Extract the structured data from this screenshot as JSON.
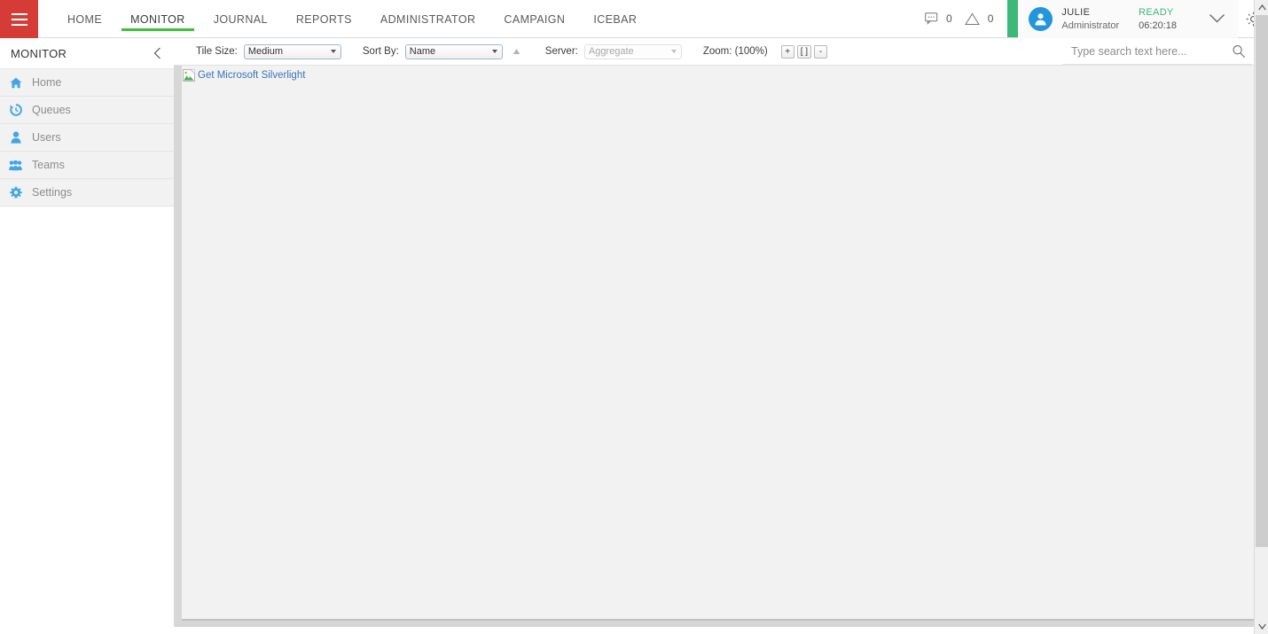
{
  "header": {
    "menu_icon": "hamburger-icon",
    "tabs": [
      {
        "label": "HOME",
        "active": false
      },
      {
        "label": "MONITOR",
        "active": true
      },
      {
        "label": "JOURNAL",
        "active": false
      },
      {
        "label": "REPORTS",
        "active": false
      },
      {
        "label": "ADMINISTRATOR",
        "active": false
      },
      {
        "label": "CAMPAIGN",
        "active": false
      },
      {
        "label": "ICEBAR",
        "active": false
      }
    ],
    "notifications": {
      "messages_icon": "chat-bubble-icon",
      "messages_count": "0",
      "alerts_icon": "warning-triangle-icon",
      "alerts_count": "0"
    },
    "user": {
      "avatar_icon": "user-avatar-icon",
      "name": "JULIE",
      "role": "Administrator",
      "status": "READY",
      "timer": "06:20:18",
      "status_color": "#3cb878",
      "chevron_icon": "chevron-down-icon"
    },
    "settings_icon": "gear-icon",
    "accent_red": "#d63c36",
    "accent_green": "#3fc03b"
  },
  "sidebar": {
    "title": "MONITOR",
    "collapse_icon": "chevron-left-icon",
    "items": [
      {
        "label": "Home",
        "icon": "home-icon"
      },
      {
        "label": "Queues",
        "icon": "history-icon"
      },
      {
        "label": "Users",
        "icon": "user-icon"
      },
      {
        "label": "Teams",
        "icon": "group-icon"
      },
      {
        "label": "Settings",
        "icon": "gear-icon"
      }
    ]
  },
  "toolbar": {
    "tile_size_label": "Tile Size:",
    "tile_size_value": "Medium",
    "sort_by_label": "Sort By:",
    "sort_by_value": "Name",
    "sort_direction_icon": "sort-ascending-icon",
    "server_label": "Server:",
    "server_value": "Aggregate",
    "zoom_label": "Zoom: (100%)",
    "zoom_in": "+",
    "zoom_fit": "[ ]",
    "zoom_out": "-"
  },
  "search": {
    "placeholder": "Type search text here...",
    "value": "",
    "icon": "search-icon"
  },
  "content": {
    "plugin_icon": "broken-image-icon",
    "plugin_link": "Get Microsoft Silverlight"
  },
  "scrollbar": {
    "up_icon": "scroll-up-arrow-icon",
    "down_icon": "scroll-down-arrow-icon"
  }
}
